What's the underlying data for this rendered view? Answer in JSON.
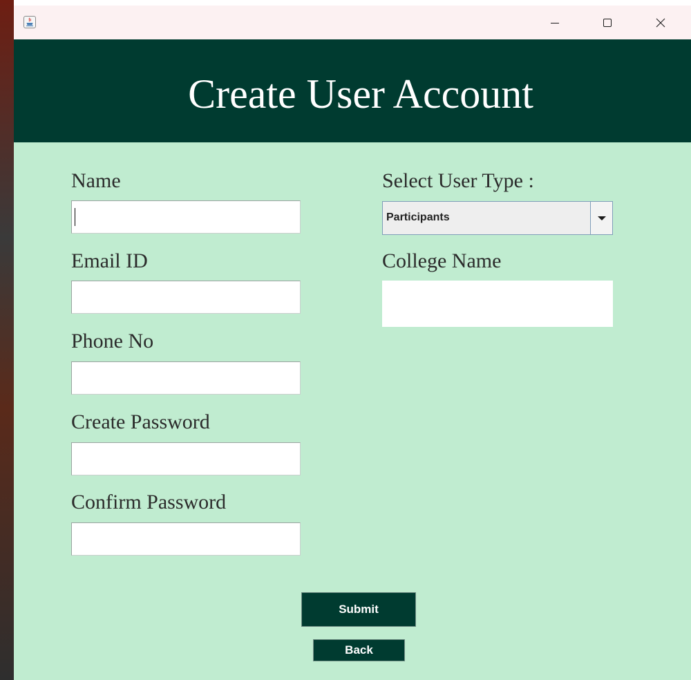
{
  "header": {
    "title": "Create User Account"
  },
  "form": {
    "name_label": "Name",
    "name_value": "",
    "email_label": "Email ID",
    "email_value": "",
    "phone_label": "Phone No",
    "phone_value": "",
    "create_password_label": "Create Password",
    "create_password_value": "",
    "confirm_password_label": "Confirm Password",
    "confirm_password_value": "",
    "user_type_label": "Select User Type :",
    "user_type_selected": "Participants",
    "college_label": "College Name",
    "college_value": ""
  },
  "buttons": {
    "submit_label": "Submit",
    "back_label": "Back"
  },
  "colors": {
    "header_bg": "#003b30",
    "form_bg": "#c0ecd0",
    "button_bg": "#003b30",
    "titlebar_bg": "#fcf1f2"
  },
  "icons": {
    "app": "java-app-icon",
    "minimize": "minimize-icon",
    "maximize": "maximize-icon",
    "close": "close-icon",
    "dropdown": "chevron-down-icon"
  }
}
